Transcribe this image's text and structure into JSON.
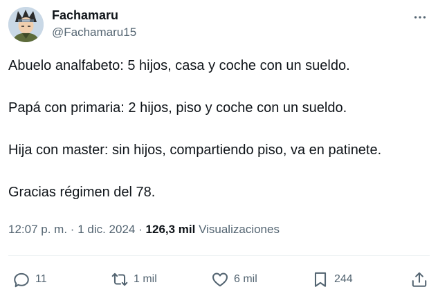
{
  "author": {
    "name": "Fachamaru",
    "handle": "@Fachamaru15"
  },
  "tweet": {
    "lines": [
      "Abuelo analfabeto: 5 hijos, casa y coche con un sueldo.",
      "Papá con primaria: 2 hijos, piso y coche con un sueldo.",
      "Hija con master: sin hijos, compartiendo piso, va en patinete.",
      "Gracias régimen del 78."
    ]
  },
  "meta": {
    "time": "12:07 p. m.",
    "separator": "·",
    "date": "1 dic. 2024",
    "views_count": "126,3 mil",
    "views_label": "Visualizaciones"
  },
  "actions": {
    "replies": "11",
    "reposts": "1 mil",
    "likes": "6 mil",
    "bookmarks": "244"
  },
  "colors": {
    "text": "#0f1419",
    "secondary": "#536471",
    "divider": "#eff3f4"
  },
  "icons": [
    "more-icon",
    "reply-icon",
    "repost-icon",
    "like-icon",
    "bookmark-icon",
    "share-icon"
  ]
}
